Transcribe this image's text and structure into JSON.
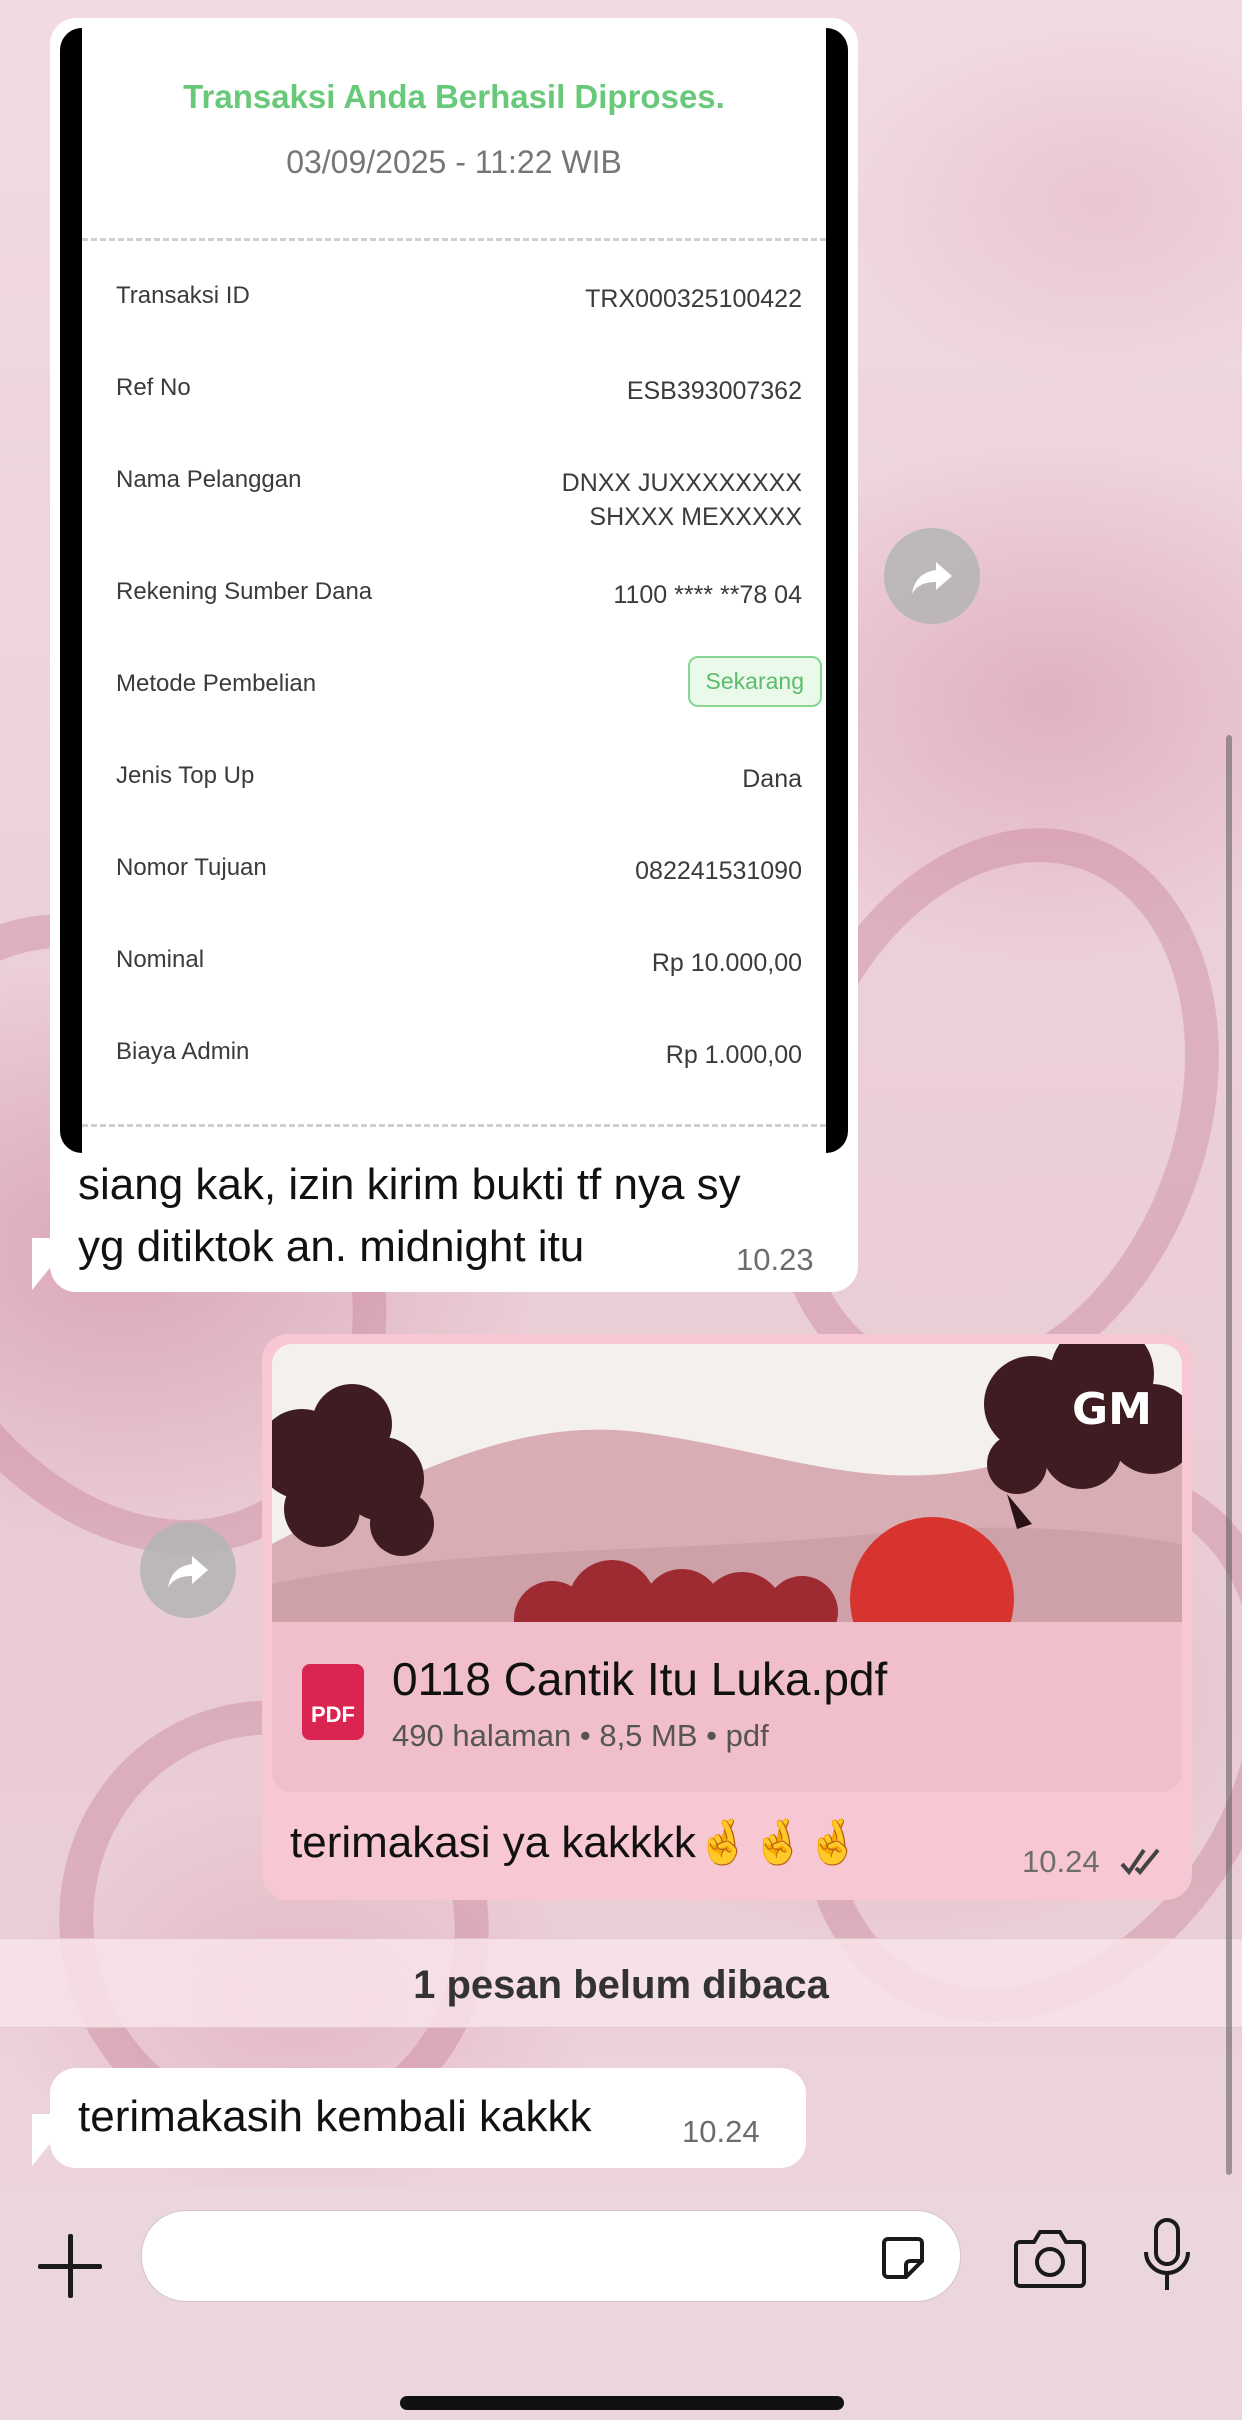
{
  "receipt": {
    "title": "Transaksi Anda Berhasil Diproses.",
    "datetime": "03/09/2025 - 11:22 WIB",
    "rows": [
      {
        "label": "Transaksi ID",
        "value": "TRX000325100422"
      },
      {
        "label": "Ref No",
        "value": "ESB393007362"
      },
      {
        "label": "Nama Pelanggan",
        "value_line1": "DNXX JUXXXXXXXX",
        "value_line2": "SHXXX MEXXXXX"
      },
      {
        "label": "Rekening Sumber Dana",
        "value": "1100 **** **78 04"
      },
      {
        "label": "Metode Pembelian",
        "value": "Sekarang"
      },
      {
        "label": "Jenis Top Up",
        "value": "Dana"
      },
      {
        "label": "Nomor Tujuan",
        "value": "082241531090"
      },
      {
        "label": "Nominal",
        "value": "Rp 10.000,00"
      },
      {
        "label": "Biaya Admin",
        "value": "Rp 1.000,00"
      }
    ]
  },
  "messages": {
    "incoming_1": {
      "line1": "siang kak, izin kirim bukti tf nya sy",
      "line2": "yg ditiktok an. midnight itu",
      "time": "10.23"
    },
    "outgoing_1": {
      "file_name": "0118 Cantik Itu Luka.pdf",
      "file_meta": "490 halaman • 8,5 MB • pdf",
      "file_icon_label": "PDF",
      "cover_logo": "GM",
      "caption": "terimakasi ya kakkkk🤞🤞🤞",
      "time": "10.24",
      "status": "read"
    },
    "unread_divider": "1 pesan belum dibaca",
    "incoming_2": {
      "text": "terimakasih kembali kakkk",
      "time": "10.24"
    }
  },
  "colors": {
    "success_green": "#69c97a",
    "outgoing_bubble": "#f7c7d3",
    "incoming_bubble": "#ffffff",
    "pdf_red": "#d9254f"
  }
}
